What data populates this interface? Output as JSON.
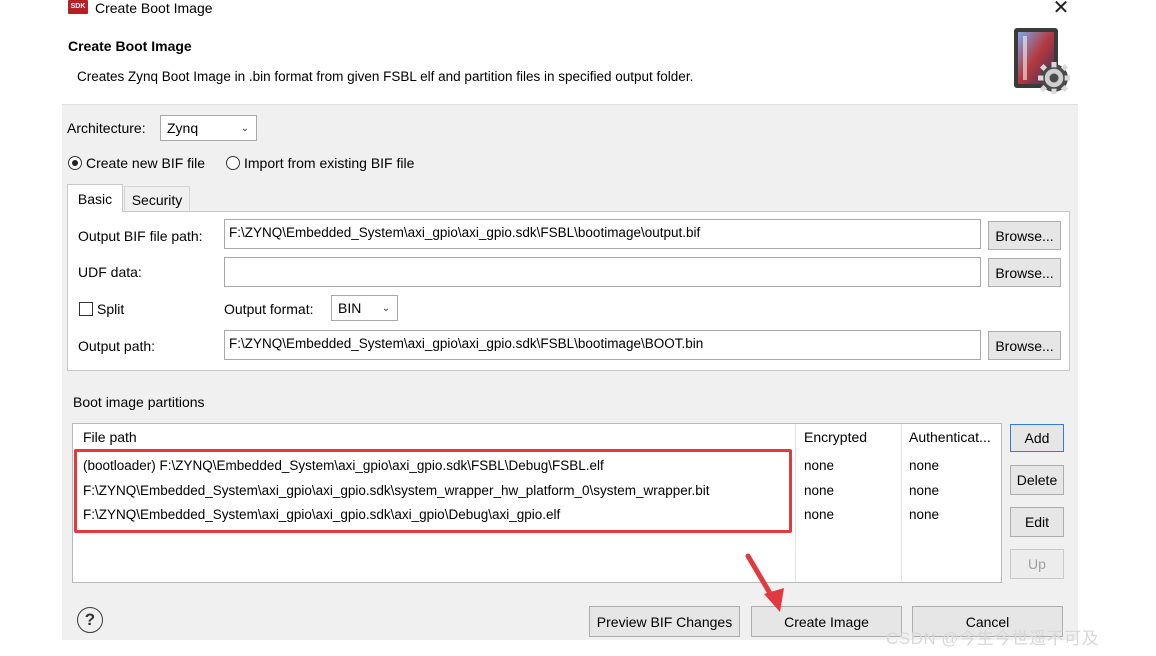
{
  "window": {
    "icon_text": "SDK",
    "title": "Create Boot Image",
    "close_glyph": "✕"
  },
  "header": {
    "title": "Create Boot Image",
    "description": "Creates Zynq Boot Image in .bin format from given FSBL elf and partition files in specified output folder.",
    "graphic": "boot-image-gear-icon"
  },
  "architecture": {
    "label": "Architecture:",
    "value": "Zynq"
  },
  "bif_mode": {
    "create_label": "Create new BIF file",
    "import_label": "Import from existing BIF file",
    "selected": "create"
  },
  "tabs": [
    {
      "label": "Basic",
      "active": true
    },
    {
      "label": "Security",
      "active": false
    }
  ],
  "basic": {
    "output_bif_label": "Output BIF file path:",
    "output_bif_value": "F:\\ZYNQ\\Embedded_System\\axi_gpio\\axi_gpio.sdk\\FSBL\\bootimage\\output.bif",
    "udf_label": "UDF data:",
    "udf_value": "",
    "split_label": "Split",
    "split_checked": false,
    "output_format_label": "Output format:",
    "output_format_value": "BIN",
    "output_path_label": "Output path:",
    "output_path_value": "F:\\ZYNQ\\Embedded_System\\axi_gpio\\axi_gpio.sdk\\FSBL\\bootimage\\BOOT.bin",
    "browse_label": "Browse..."
  },
  "partitions": {
    "section_label": "Boot image partitions",
    "columns": [
      "File path",
      "Encrypted",
      "Authenticat..."
    ],
    "rows": [
      {
        "file": "(bootloader) F:\\ZYNQ\\Embedded_System\\axi_gpio\\axi_gpio.sdk\\FSBL\\Debug\\FSBL.elf",
        "encrypted": "none",
        "auth": "none"
      },
      {
        "file": "F:\\ZYNQ\\Embedded_System\\axi_gpio\\axi_gpio.sdk\\system_wrapper_hw_platform_0\\system_wrapper.bit",
        "encrypted": "none",
        "auth": "none"
      },
      {
        "file": "F:\\ZYNQ\\Embedded_System\\axi_gpio\\axi_gpio.sdk\\axi_gpio\\Debug\\axi_gpio.elf",
        "encrypted": "none",
        "auth": "none"
      }
    ],
    "buttons": {
      "add": "Add",
      "delete": "Delete",
      "edit": "Edit",
      "up": "Up"
    }
  },
  "footer": {
    "help_glyph": "?",
    "preview": "Preview BIF Changes",
    "create": "Create Image",
    "cancel": "Cancel"
  },
  "annotation": {
    "highlight_color": "#e0393e",
    "arrow_color": "#e0393e"
  },
  "watermark": "CSDN @今生今世遥不可及"
}
